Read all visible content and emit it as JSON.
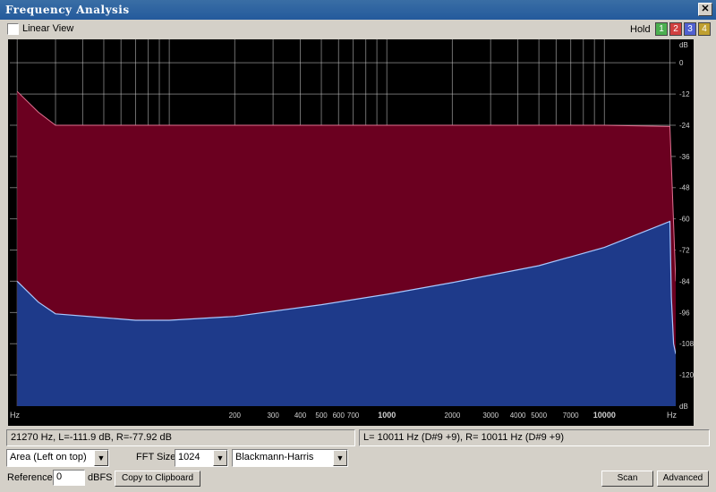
{
  "window": {
    "title": "Frequency Analysis",
    "close_glyph": "✕"
  },
  "topbar": {
    "linear_view_label": "Linear View",
    "hold_label": "Hold",
    "hold_buttons": [
      {
        "label": "1",
        "color": "#4caf50"
      },
      {
        "label": "2",
        "color": "#d04040"
      },
      {
        "label": "3",
        "color": "#5060d0"
      },
      {
        "label": "4",
        "color": "#c0a030"
      }
    ]
  },
  "plot": {
    "db_unit": "dB",
    "hz_unit": "Hz",
    "db_ticks": [
      "0",
      "-12",
      "-24",
      "-36",
      "-48",
      "-60",
      "-72",
      "-84",
      "-96",
      "-108",
      "-120"
    ],
    "freq_ticks": [
      "200",
      "300",
      "400",
      "500",
      "600",
      "700",
      "1000",
      "2000",
      "3000",
      "4000",
      "5000",
      "7000",
      "10000"
    ],
    "colors": {
      "background": "#000000",
      "left_fill": "#6b0020",
      "right_fill": "#1e3a8a",
      "grid": "#c8c8c8"
    }
  },
  "chart_data": {
    "type": "area",
    "x_scale": "log",
    "xlabel": "Hz",
    "ylabel": "dB",
    "ylim": [
      -132,
      9
    ],
    "db_ticks": [
      0,
      -12,
      -24,
      -36,
      -48,
      -60,
      -72,
      -84,
      -96,
      -108,
      -120
    ],
    "x_ticks": [
      200,
      300,
      400,
      500,
      600,
      700,
      1000,
      2000,
      3000,
      4000,
      5000,
      7000,
      10000
    ],
    "series": [
      {
        "name": "Left",
        "x": [
          20,
          25,
          30,
          100,
          1000,
          10000,
          20000,
          20500,
          21000,
          21270
        ],
        "values": [
          -11,
          -19,
          -24,
          -24,
          -24,
          -24,
          -24.5,
          -48,
          -72,
          -84
        ]
      },
      {
        "name": "Right",
        "x": [
          20,
          25,
          30,
          50,
          70,
          100,
          200,
          500,
          1000,
          2000,
          5000,
          10000,
          20000,
          20300,
          20800,
          21270
        ],
        "values": [
          -84,
          -92,
          -96.5,
          -98,
          -99,
          -99,
          -97.5,
          -93,
          -89,
          -84.5,
          -78,
          -71,
          -61,
          -90,
          -108,
          -111.9
        ]
      }
    ]
  },
  "status": {
    "left_text": "21270 Hz, L=-111.9 dB, R=-77.92 dB",
    "right_text": "L=  10011 Hz (D#9 +9), R=  10011 Hz (D#9 +9)"
  },
  "controls": {
    "mode_value": "Area (Left on top)",
    "fft_label": "FFT Size",
    "fft_value": "1024",
    "window_value": "Blackmann-Harris",
    "reference_label": "Reference",
    "reference_value": "0",
    "dbfs_label": "dBFS",
    "copy_label": "Copy to Clipboard",
    "scan_label": "Scan",
    "advanced_label": "Advanced"
  }
}
